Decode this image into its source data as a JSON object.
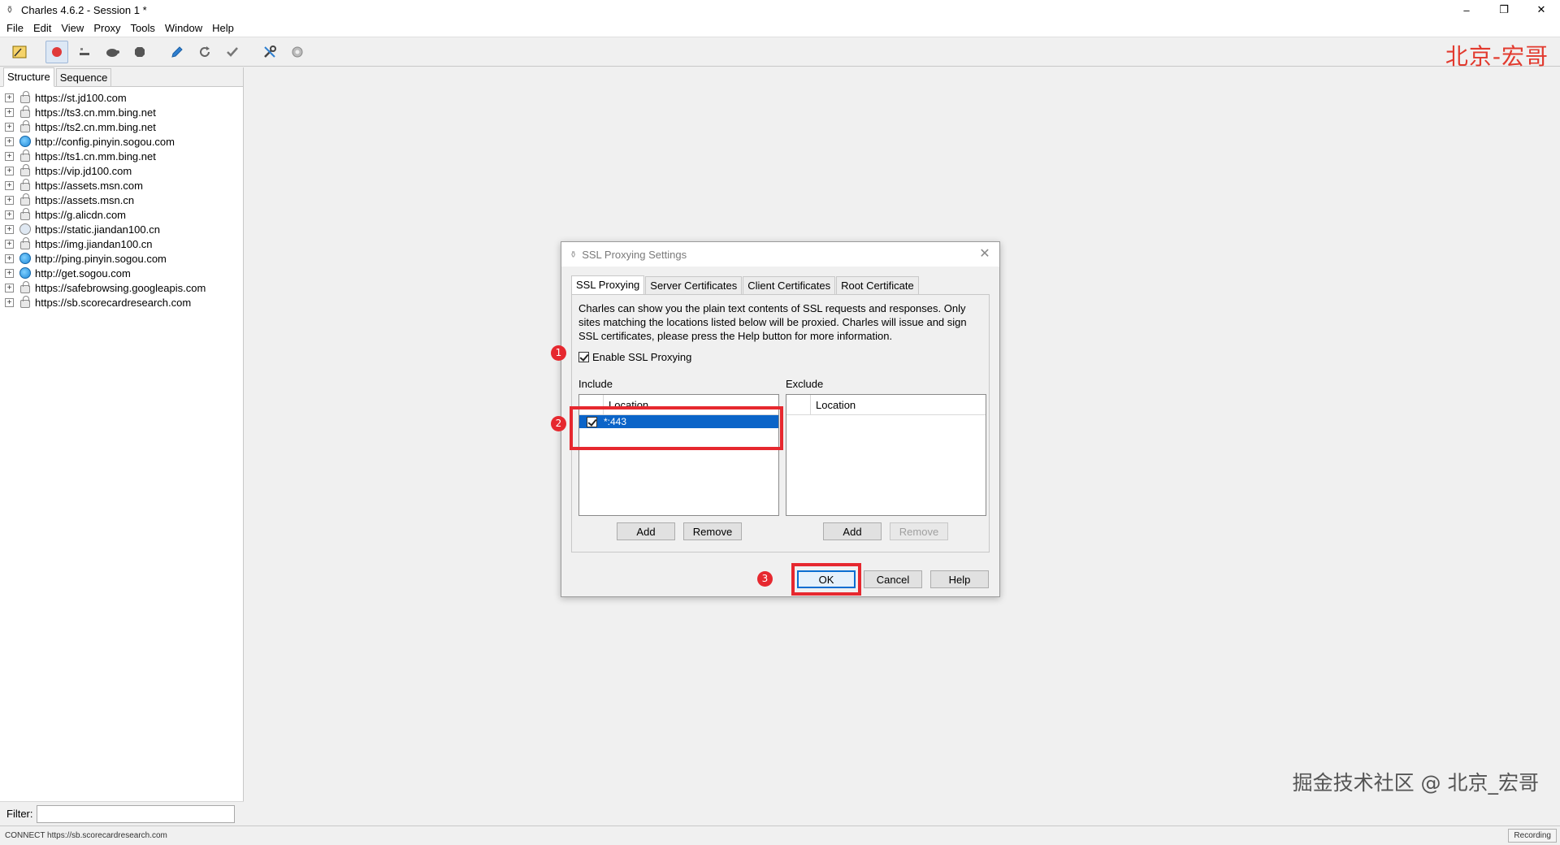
{
  "window": {
    "title": "Charles 4.6.2 - Session 1 *",
    "controls": [
      "–",
      "❐",
      "✕"
    ]
  },
  "menu": [
    {
      "label": "File"
    },
    {
      "label": "Edit"
    },
    {
      "label": "View"
    },
    {
      "label": "Proxy"
    },
    {
      "label": "Tools"
    },
    {
      "label": "Window"
    },
    {
      "label": "Help"
    }
  ],
  "toolbar": {
    "icons": [
      "broom-icon",
      "record-icon",
      "throttle-icon",
      "turtle-icon",
      "stop-icon",
      "pen-icon",
      "refresh-icon",
      "check-icon",
      "tools-icon",
      "settings-gear-icon"
    ],
    "brand": "北京-宏哥"
  },
  "left_panel": {
    "tabs": [
      {
        "label": "Structure"
      },
      {
        "label": "Sequence"
      }
    ],
    "hosts": [
      {
        "url": "https://st.jd100.com",
        "icon": "lock"
      },
      {
        "url": "https://ts3.cn.mm.bing.net",
        "icon": "lock"
      },
      {
        "url": "https://ts2.cn.mm.bing.net",
        "icon": "lock"
      },
      {
        "url": "http://config.pinyin.sogou.com",
        "icon": "globe"
      },
      {
        "url": "https://ts1.cn.mm.bing.net",
        "icon": "lock"
      },
      {
        "url": "https://vip.jd100.com",
        "icon": "lock"
      },
      {
        "url": "https://assets.msn.com",
        "icon": "lock"
      },
      {
        "url": "https://assets.msn.cn",
        "icon": "lock"
      },
      {
        "url": "https://g.alicdn.com",
        "icon": "lock"
      },
      {
        "url": "https://static.jiandan100.cn",
        "icon": "lockglobe"
      },
      {
        "url": "https://img.jiandan100.cn",
        "icon": "lock"
      },
      {
        "url": "http://ping.pinyin.sogou.com",
        "icon": "globe"
      },
      {
        "url": "http://get.sogou.com",
        "icon": "globe"
      },
      {
        "url": "https://safebrowsing.googleapis.com",
        "icon": "lock"
      },
      {
        "url": "https://sb.scorecardresearch.com",
        "icon": "lock"
      }
    ],
    "filter_label": "Filter:",
    "filter_value": ""
  },
  "status": {
    "text": "CONNECT https://sb.scorecardresearch.com",
    "recording": "Recording"
  },
  "watermark": "掘金技术社区 @ 北京_宏哥",
  "dialog": {
    "title": "SSL Proxying Settings",
    "tabs": [
      {
        "label": "SSL Proxying"
      },
      {
        "label": "Server Certificates"
      },
      {
        "label": "Client Certificates"
      },
      {
        "label": "Root Certificate"
      }
    ],
    "description": "Charles can show you the plain text contents of SSL requests and responses. Only sites matching the locations listed below will be proxied. Charles will issue and sign SSL certificates, please press the Help button for more information.",
    "enable_label": "Enable SSL Proxying",
    "enable_checked": true,
    "include": {
      "label": "Include",
      "column": "Location",
      "rows": [
        {
          "location": "*:443",
          "checked": true
        }
      ],
      "add": "Add",
      "remove": "Remove"
    },
    "exclude": {
      "label": "Exclude",
      "column": "Location",
      "rows": [],
      "add": "Add",
      "remove": "Remove"
    },
    "buttons": {
      "ok": "OK",
      "cancel": "Cancel",
      "help": "Help"
    },
    "annotations": [
      "1",
      "2",
      "3"
    ],
    "annotation_color": "#e6282f"
  }
}
